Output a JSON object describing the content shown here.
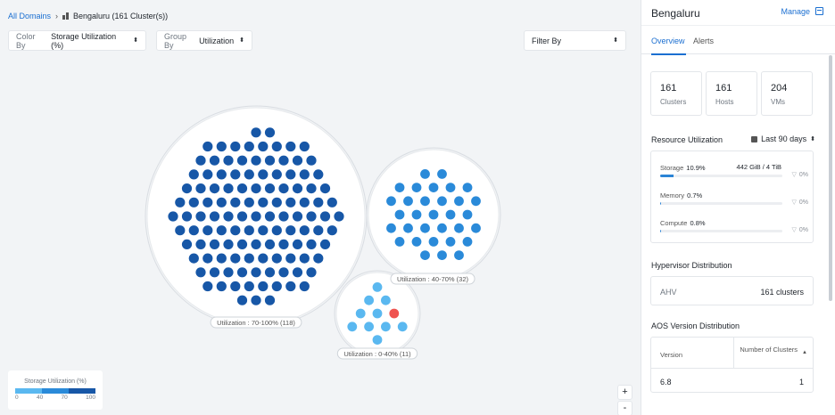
{
  "breadcrumb": {
    "root": "All Domains",
    "separator": "›",
    "current": "Bengaluru (161 Cluster(s))"
  },
  "controls": {
    "color_by": {
      "label": "Color By",
      "value": "Storage Utilization (%)"
    },
    "group_by": {
      "label": "Group By",
      "value": "Utilization"
    },
    "filter_by": {
      "label": "Filter By"
    }
  },
  "groups": [
    {
      "label": "Utilization : 70-100% (118)",
      "count": 118,
      "color": "#1757a7"
    },
    {
      "label": "Utilization : 40-70% (32)",
      "count": 32,
      "color": "#2a8ad9"
    },
    {
      "label": "Utilization : 0-40% (11)",
      "count": 11,
      "color": "#5ab8f0",
      "alert_color": "#ef5350"
    }
  ],
  "legend": {
    "title": "Storage Utilization (%)",
    "ticks": [
      "0",
      "40",
      "70",
      "100"
    ],
    "colors": [
      "#5ab8f0",
      "#2a8ad9",
      "#1757a7"
    ]
  },
  "zoom": {
    "in": "+",
    "out": "-"
  },
  "panel": {
    "title": "Bengaluru",
    "manage": "Manage",
    "tabs": [
      "Overview",
      "Alerts"
    ],
    "stats": [
      {
        "value": "161",
        "label": "Clusters"
      },
      {
        "value": "161",
        "label": "Hosts"
      },
      {
        "value": "204",
        "label": "VMs"
      }
    ],
    "resource_utilization": {
      "title": "Resource Utilization",
      "range": "Last 90 days",
      "rows": [
        {
          "name": "Storage",
          "value": "10.9%",
          "capacity": "442 GiB / 4 TiB",
          "filter": "0%",
          "fraction": 0.109
        },
        {
          "name": "Memory",
          "value": "0.7%",
          "capacity": "",
          "filter": "0%",
          "fraction": 0.007
        },
        {
          "name": "Compute",
          "value": "0.8%",
          "capacity": "",
          "filter": "0%",
          "fraction": 0.008
        }
      ]
    },
    "hypervisor": {
      "title": "Hypervisor Distribution",
      "name": "AHV",
      "count": "161 clusters"
    },
    "aos": {
      "title": "AOS Version Distribution",
      "col_version": "Version",
      "col_clusters": "Number of Clusters",
      "rows": [
        {
          "version": "6.8",
          "clusters": "1"
        }
      ]
    }
  }
}
